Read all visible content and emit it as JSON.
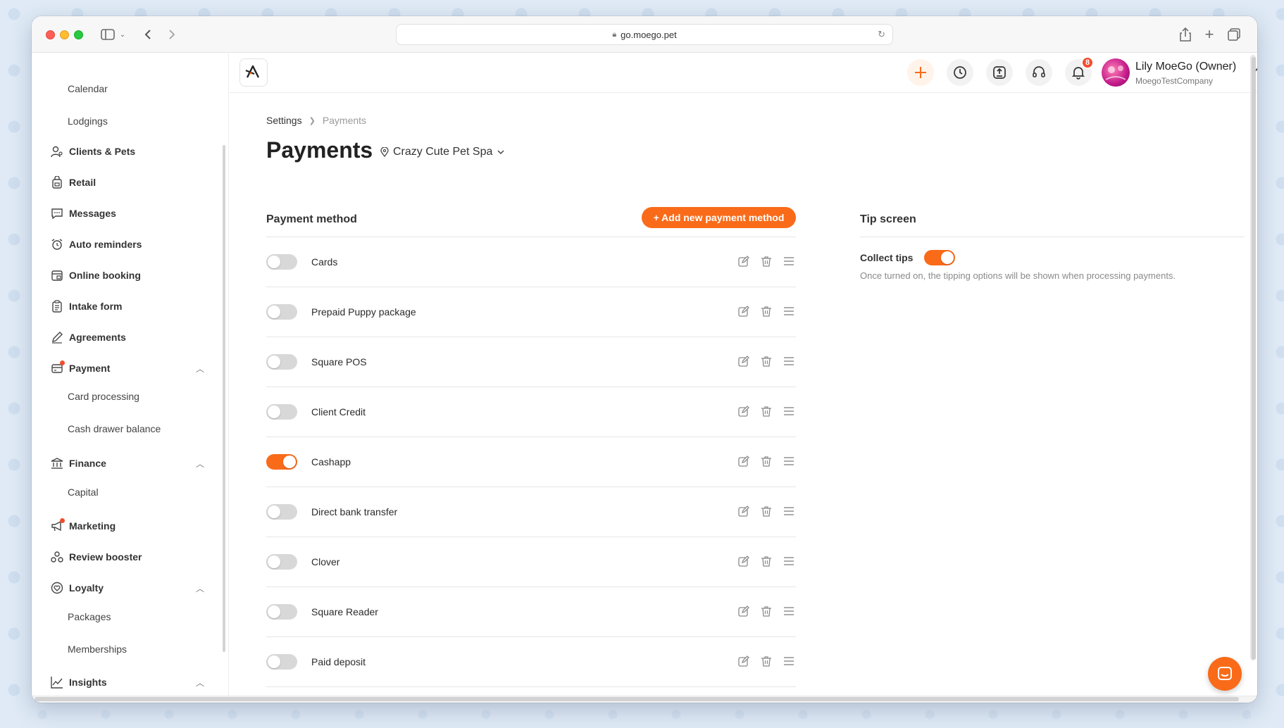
{
  "browser": {
    "url": "go.moego.pet"
  },
  "sidebar": {
    "items": [
      {
        "label": "Calendar",
        "type": "sub"
      },
      {
        "label": "Lodgings",
        "type": "sub"
      },
      {
        "label": "Clients & Pets",
        "icon": "clients-icon"
      },
      {
        "label": "Retail",
        "icon": "retail-icon"
      },
      {
        "label": "Messages",
        "icon": "messages-icon"
      },
      {
        "label": "Auto reminders",
        "icon": "alarm-icon"
      },
      {
        "label": "Online booking",
        "icon": "online-booking-icon"
      },
      {
        "label": "Intake form",
        "icon": "clipboard-icon"
      },
      {
        "label": "Agreements",
        "icon": "pen-icon"
      },
      {
        "label": "Payment",
        "icon": "payment-icon",
        "expanded": true,
        "dot": true
      },
      {
        "label": "Card processing",
        "type": "sub"
      },
      {
        "label": "Cash drawer balance",
        "type": "sub"
      },
      {
        "label": "Finance",
        "icon": "bank-icon",
        "expanded": true
      },
      {
        "label": "Capital",
        "type": "sub"
      },
      {
        "label": "Marketing",
        "icon": "megaphone-icon",
        "dot": true
      },
      {
        "label": "Review booster",
        "icon": "review-icon"
      },
      {
        "label": "Loyalty",
        "icon": "loyalty-icon",
        "expanded": true
      },
      {
        "label": "Packages",
        "type": "sub"
      },
      {
        "label": "Memberships",
        "type": "sub"
      },
      {
        "label": "Insights",
        "icon": "insights-icon",
        "expanded": true
      }
    ]
  },
  "header": {
    "notification_count": "8",
    "user_name": "Lily MoeGo (Owner)",
    "company": "MoegoTestCompany"
  },
  "breadcrumb": {
    "parent": "Settings",
    "current": "Payments"
  },
  "page": {
    "title": "Payments",
    "location": "Crazy Cute Pet Spa"
  },
  "payment_methods": {
    "title": "Payment method",
    "add_label": "+ Add new payment method",
    "items": [
      {
        "name": "Cards",
        "enabled": false
      },
      {
        "name": "Prepaid Puppy package",
        "enabled": false
      },
      {
        "name": "Square POS",
        "enabled": false
      },
      {
        "name": "Client Credit",
        "enabled": false
      },
      {
        "name": "Cashapp",
        "enabled": true
      },
      {
        "name": "Direct bank transfer",
        "enabled": false
      },
      {
        "name": "Clover",
        "enabled": false
      },
      {
        "name": "Square Reader",
        "enabled": false
      },
      {
        "name": "Paid deposit",
        "enabled": false
      }
    ]
  },
  "tip_screen": {
    "title": "Tip screen",
    "collect_label": "Collect tips",
    "collect_enabled": true,
    "description": "Once turned on, the tipping options will be shown when processing payments."
  },
  "colors": {
    "accent": "#f96b19",
    "alert": "#f04e2f"
  }
}
